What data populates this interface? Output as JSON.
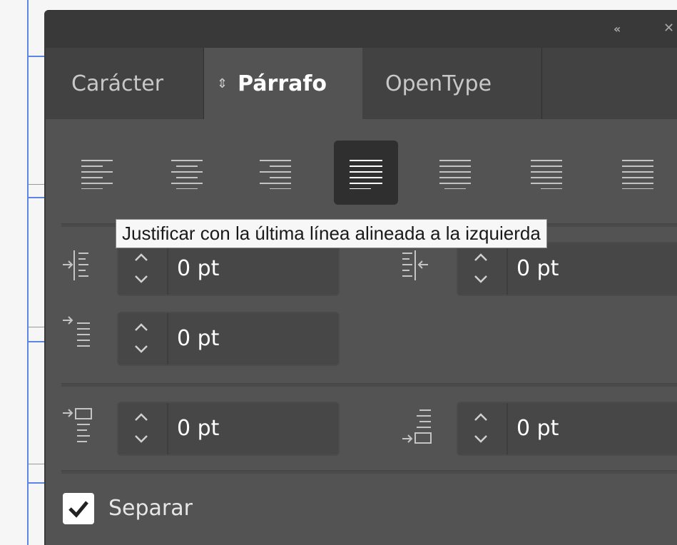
{
  "panel": {
    "collapse_icon": "double-chevron-left-icon",
    "close_icon": "close-icon"
  },
  "tabs": [
    {
      "label": "Carácter",
      "active": false
    },
    {
      "label": "Párrafo",
      "active": true
    },
    {
      "label": "OpenType",
      "active": false
    }
  ],
  "alignment": {
    "buttons": [
      {
        "name": "align-left"
      },
      {
        "name": "align-center"
      },
      {
        "name": "align-right"
      },
      {
        "name": "justify-last-left",
        "selected": true
      },
      {
        "name": "justify-last-center"
      },
      {
        "name": "justify-last-right"
      },
      {
        "name": "justify-all"
      }
    ],
    "tooltip": "Justificar con la última línea alineada a la izquierda"
  },
  "indents": {
    "left_indent": "0 pt",
    "right_indent": "0 pt",
    "first_line_indent": "0 pt"
  },
  "spacing": {
    "space_before": "0 pt",
    "space_after": "0 pt"
  },
  "hyphenate": {
    "label": "Separar",
    "checked": true
  },
  "colors": {
    "panel_bg": "#535353",
    "tab_bar_bg": "#393939",
    "selected_button_bg": "#2f2f2f",
    "guide_blue": "#5b86e5"
  }
}
